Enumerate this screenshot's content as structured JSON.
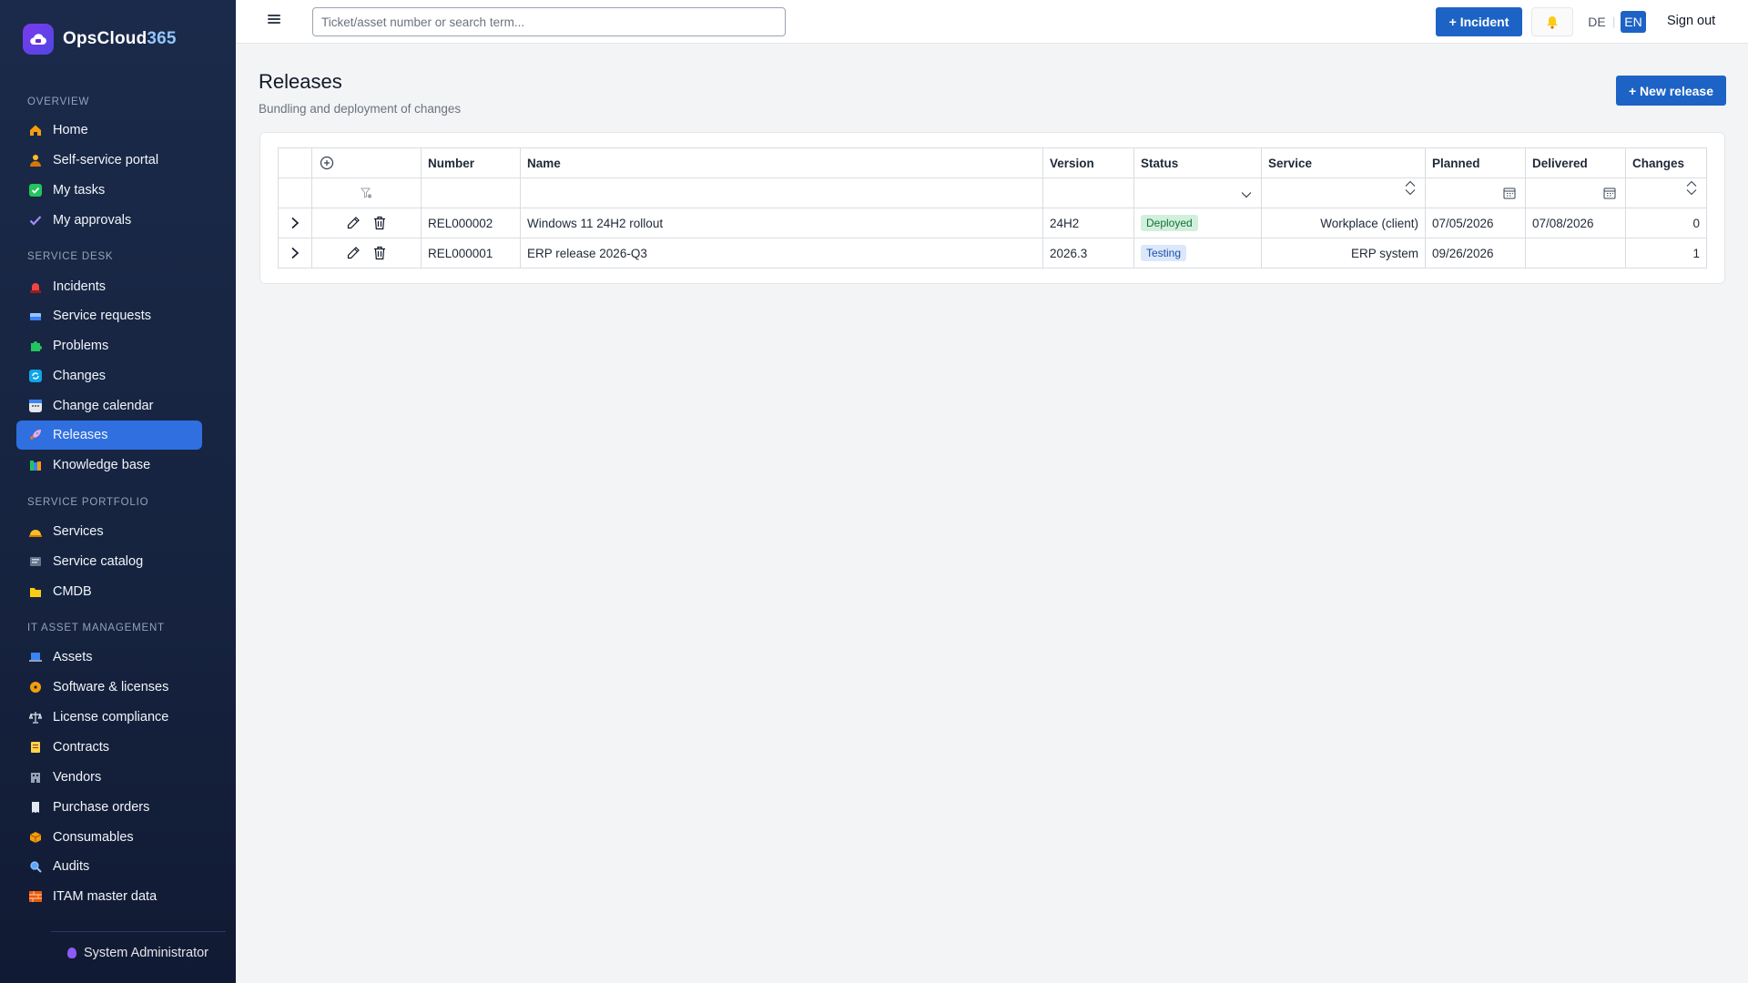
{
  "app": {
    "name_main": "OpsCloud",
    "name_accent": "365"
  },
  "colors": {
    "accent": "#1d63c6",
    "sidebar_bg": "#1b2a4a",
    "active_item": "#2f6fe0",
    "deployed": "#14703a",
    "testing": "#1e4fa3"
  },
  "sidebar": {
    "sections": [
      {
        "title": "OVERVIEW",
        "items": [
          {
            "label": "Home",
            "icon": "home-icon"
          },
          {
            "label": "Self-service portal",
            "icon": "person-icon"
          },
          {
            "label": "My tasks",
            "icon": "check-box-icon"
          },
          {
            "label": "My approvals",
            "icon": "checkmark-icon"
          }
        ]
      },
      {
        "title": "SERVICE DESK",
        "items": [
          {
            "label": "Incidents",
            "icon": "siren-icon"
          },
          {
            "label": "Service requests",
            "icon": "inbox-icon"
          },
          {
            "label": "Problems",
            "icon": "puzzle-icon"
          },
          {
            "label": "Changes",
            "icon": "cycle-icon"
          },
          {
            "label": "Change calendar",
            "icon": "calendar-icon"
          },
          {
            "label": "Releases",
            "icon": "rocket-icon",
            "active": true
          },
          {
            "label": "Knowledge base",
            "icon": "books-icon"
          }
        ]
      },
      {
        "title": "SERVICE PORTFOLIO",
        "items": [
          {
            "label": "Services",
            "icon": "bell-service-icon"
          },
          {
            "label": "Service catalog",
            "icon": "catalog-icon"
          },
          {
            "label": "CMDB",
            "icon": "folder-icon"
          }
        ]
      },
      {
        "title": "IT ASSET MANAGEMENT",
        "items": [
          {
            "label": "Assets",
            "icon": "laptop-icon"
          },
          {
            "label": "Software & licenses",
            "icon": "disc-icon"
          },
          {
            "label": "License compliance",
            "icon": "scales-icon"
          },
          {
            "label": "Contracts",
            "icon": "scroll-icon"
          },
          {
            "label": "Vendors",
            "icon": "building-icon"
          },
          {
            "label": "Purchase orders",
            "icon": "receipt-icon"
          },
          {
            "label": "Consumables",
            "icon": "box-icon"
          },
          {
            "label": "Audits",
            "icon": "magnifier-icon"
          },
          {
            "label": "ITAM master data",
            "icon": "bricks-icon"
          }
        ]
      }
    ],
    "user": "System Administrator"
  },
  "topbar": {
    "search_placeholder": "Ticket/asset number or search term...",
    "incident_button": "+ Incident",
    "lang_de": "DE",
    "lang_sep": "|",
    "lang_en": "EN",
    "sign_out": "Sign out"
  },
  "page": {
    "title": "Releases",
    "subtitle": "Bundling and deployment of changes",
    "new_button": "+ New release"
  },
  "table": {
    "columns": [
      "Number",
      "Name",
      "Version",
      "Status",
      "Service",
      "Planned",
      "Delivered",
      "Changes"
    ],
    "rows": [
      {
        "number": "REL000002",
        "name": "Windows 11 24H2 rollout",
        "version": "24H2",
        "status": "Deployed",
        "service": "Workplace (client)",
        "planned": "07/05/2026",
        "delivered": "07/08/2026",
        "changes": "0"
      },
      {
        "number": "REL000001",
        "name": "ERP release 2026-Q3",
        "version": "2026.3",
        "status": "Testing",
        "service": "ERP system",
        "planned": "09/26/2026",
        "delivered": "",
        "changes": "1"
      }
    ]
  }
}
